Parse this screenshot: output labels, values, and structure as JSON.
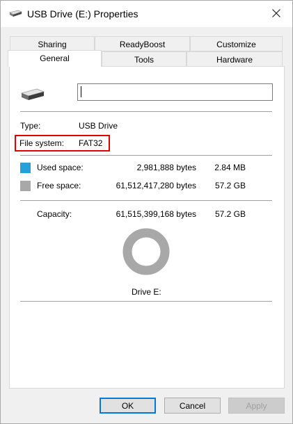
{
  "window": {
    "title": "USB Drive (E:) Properties",
    "icon": "drive-icon",
    "close_icon": "close-icon"
  },
  "tabs": {
    "row1": [
      "Sharing",
      "ReadyBoost",
      "Customize"
    ],
    "row2": [
      "General",
      "Tools",
      "Hardware"
    ],
    "active": "General"
  },
  "general": {
    "drive_icon": "usb-drive-icon",
    "name_value": "",
    "type_label": "Type:",
    "type_value": "USB Drive",
    "fs_label": "File system:",
    "fs_value": "FAT32",
    "used_label": "Used space:",
    "used_bytes": "2,981,888 bytes",
    "used_size": "2.84 MB",
    "free_label": "Free space:",
    "free_bytes": "61,512,417,280 bytes",
    "free_size": "57.2 GB",
    "capacity_label": "Capacity:",
    "capacity_bytes": "61,515,399,168 bytes",
    "capacity_size": "57.2 GB",
    "drive_label": "Drive E:",
    "used_color": "#26a0da",
    "free_color": "#a8a8a8",
    "used_fraction": 4.85e-05
  },
  "buttons": {
    "ok": "OK",
    "cancel": "Cancel",
    "apply": "Apply"
  },
  "highlight_color": "#e00000"
}
